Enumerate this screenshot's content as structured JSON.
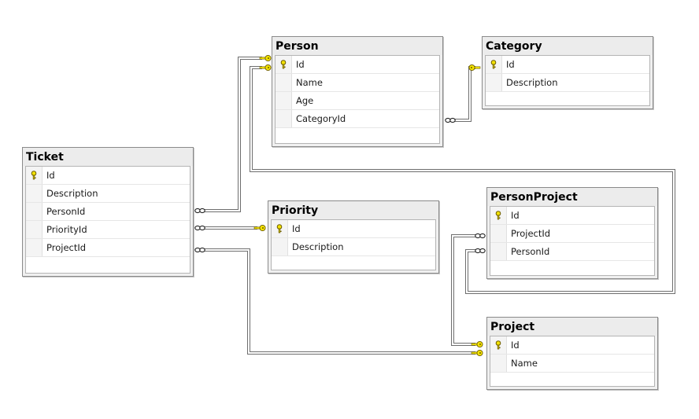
{
  "diagram": {
    "entities": {
      "person": {
        "title": "Person",
        "columns": [
          "Id",
          "Name",
          "Age",
          "CategoryId"
        ]
      },
      "category": {
        "title": "Category",
        "columns": [
          "Id",
          "Description"
        ]
      },
      "ticket": {
        "title": "Ticket",
        "columns": [
          "Id",
          "Description",
          "PersonId",
          "PriorityId",
          "ProjectId"
        ]
      },
      "priority": {
        "title": "Priority",
        "columns": [
          "Id",
          "Description"
        ]
      },
      "personproject": {
        "title": "PersonProject",
        "columns": [
          "Id",
          "ProjectId",
          "PersonId"
        ]
      },
      "project": {
        "title": "Project",
        "columns": [
          "Id",
          "Name"
        ]
      }
    },
    "primary_key_column": "Id",
    "relationships": [
      {
        "from": "Ticket.PersonId",
        "to": "Person.Id",
        "from_end": "many",
        "to_end": "one"
      },
      {
        "from": "Ticket.PriorityId",
        "to": "Priority.Id",
        "from_end": "many",
        "to_end": "one"
      },
      {
        "from": "Ticket.ProjectId",
        "to": "Project.Id",
        "from_end": "many",
        "to_end": "one"
      },
      {
        "from": "Person.CategoryId",
        "to": "Category.Id",
        "from_end": "many",
        "to_end": "one"
      },
      {
        "from": "PersonProject.PersonId",
        "to": "Person.Id",
        "from_end": "many",
        "to_end": "one"
      },
      {
        "from": "PersonProject.ProjectId",
        "to": "Project.Id",
        "from_end": "many",
        "to_end": "one"
      }
    ],
    "colors": {
      "key_fill": "#f2e200",
      "key_stroke": "#6b5a00",
      "line_outer": "#6e6e6e",
      "line_inner": "#ffffff"
    }
  }
}
